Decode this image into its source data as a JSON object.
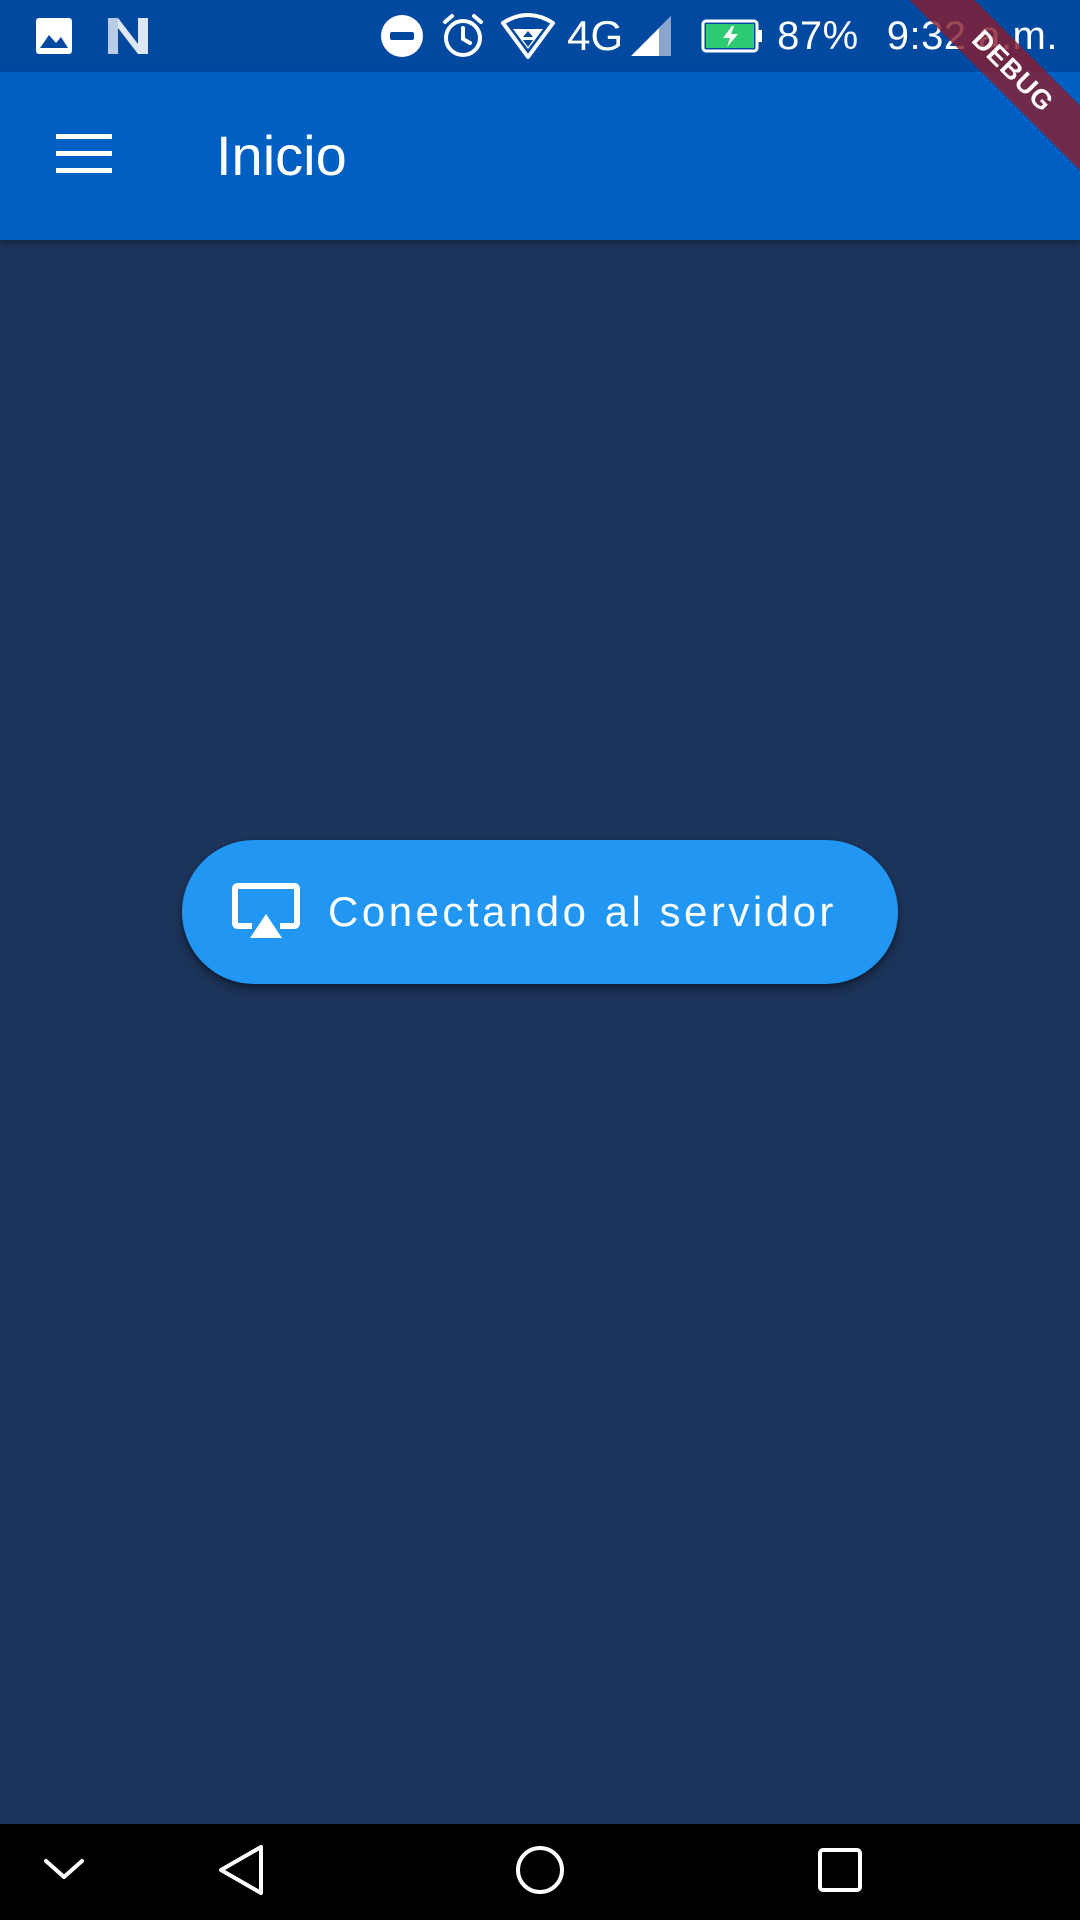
{
  "status_bar": {
    "battery_percent": "87%",
    "time": "9:32 a.m.",
    "network_type": "4G",
    "icons": [
      "image-icon",
      "n-app-icon",
      "do-not-disturb-icon",
      "alarm-icon",
      "wifi-icon",
      "cell-signal-icon",
      "battery-charging-icon"
    ],
    "battery_color": "#2ecc71"
  },
  "app_bar": {
    "title": "Inicio",
    "menu_icon": "hamburger-menu-icon",
    "color": "#005fc2"
  },
  "debug_banner": {
    "label": "DEBUG"
  },
  "main": {
    "background": "#1d355c",
    "connect_button": {
      "label": "Conectando al servidor",
      "icon": "cast-airplay-icon",
      "color": "#2196f3"
    }
  },
  "nav_bar": {
    "buttons": [
      "collapse-chevron-icon",
      "back-icon",
      "home-icon",
      "recents-icon"
    ]
  }
}
